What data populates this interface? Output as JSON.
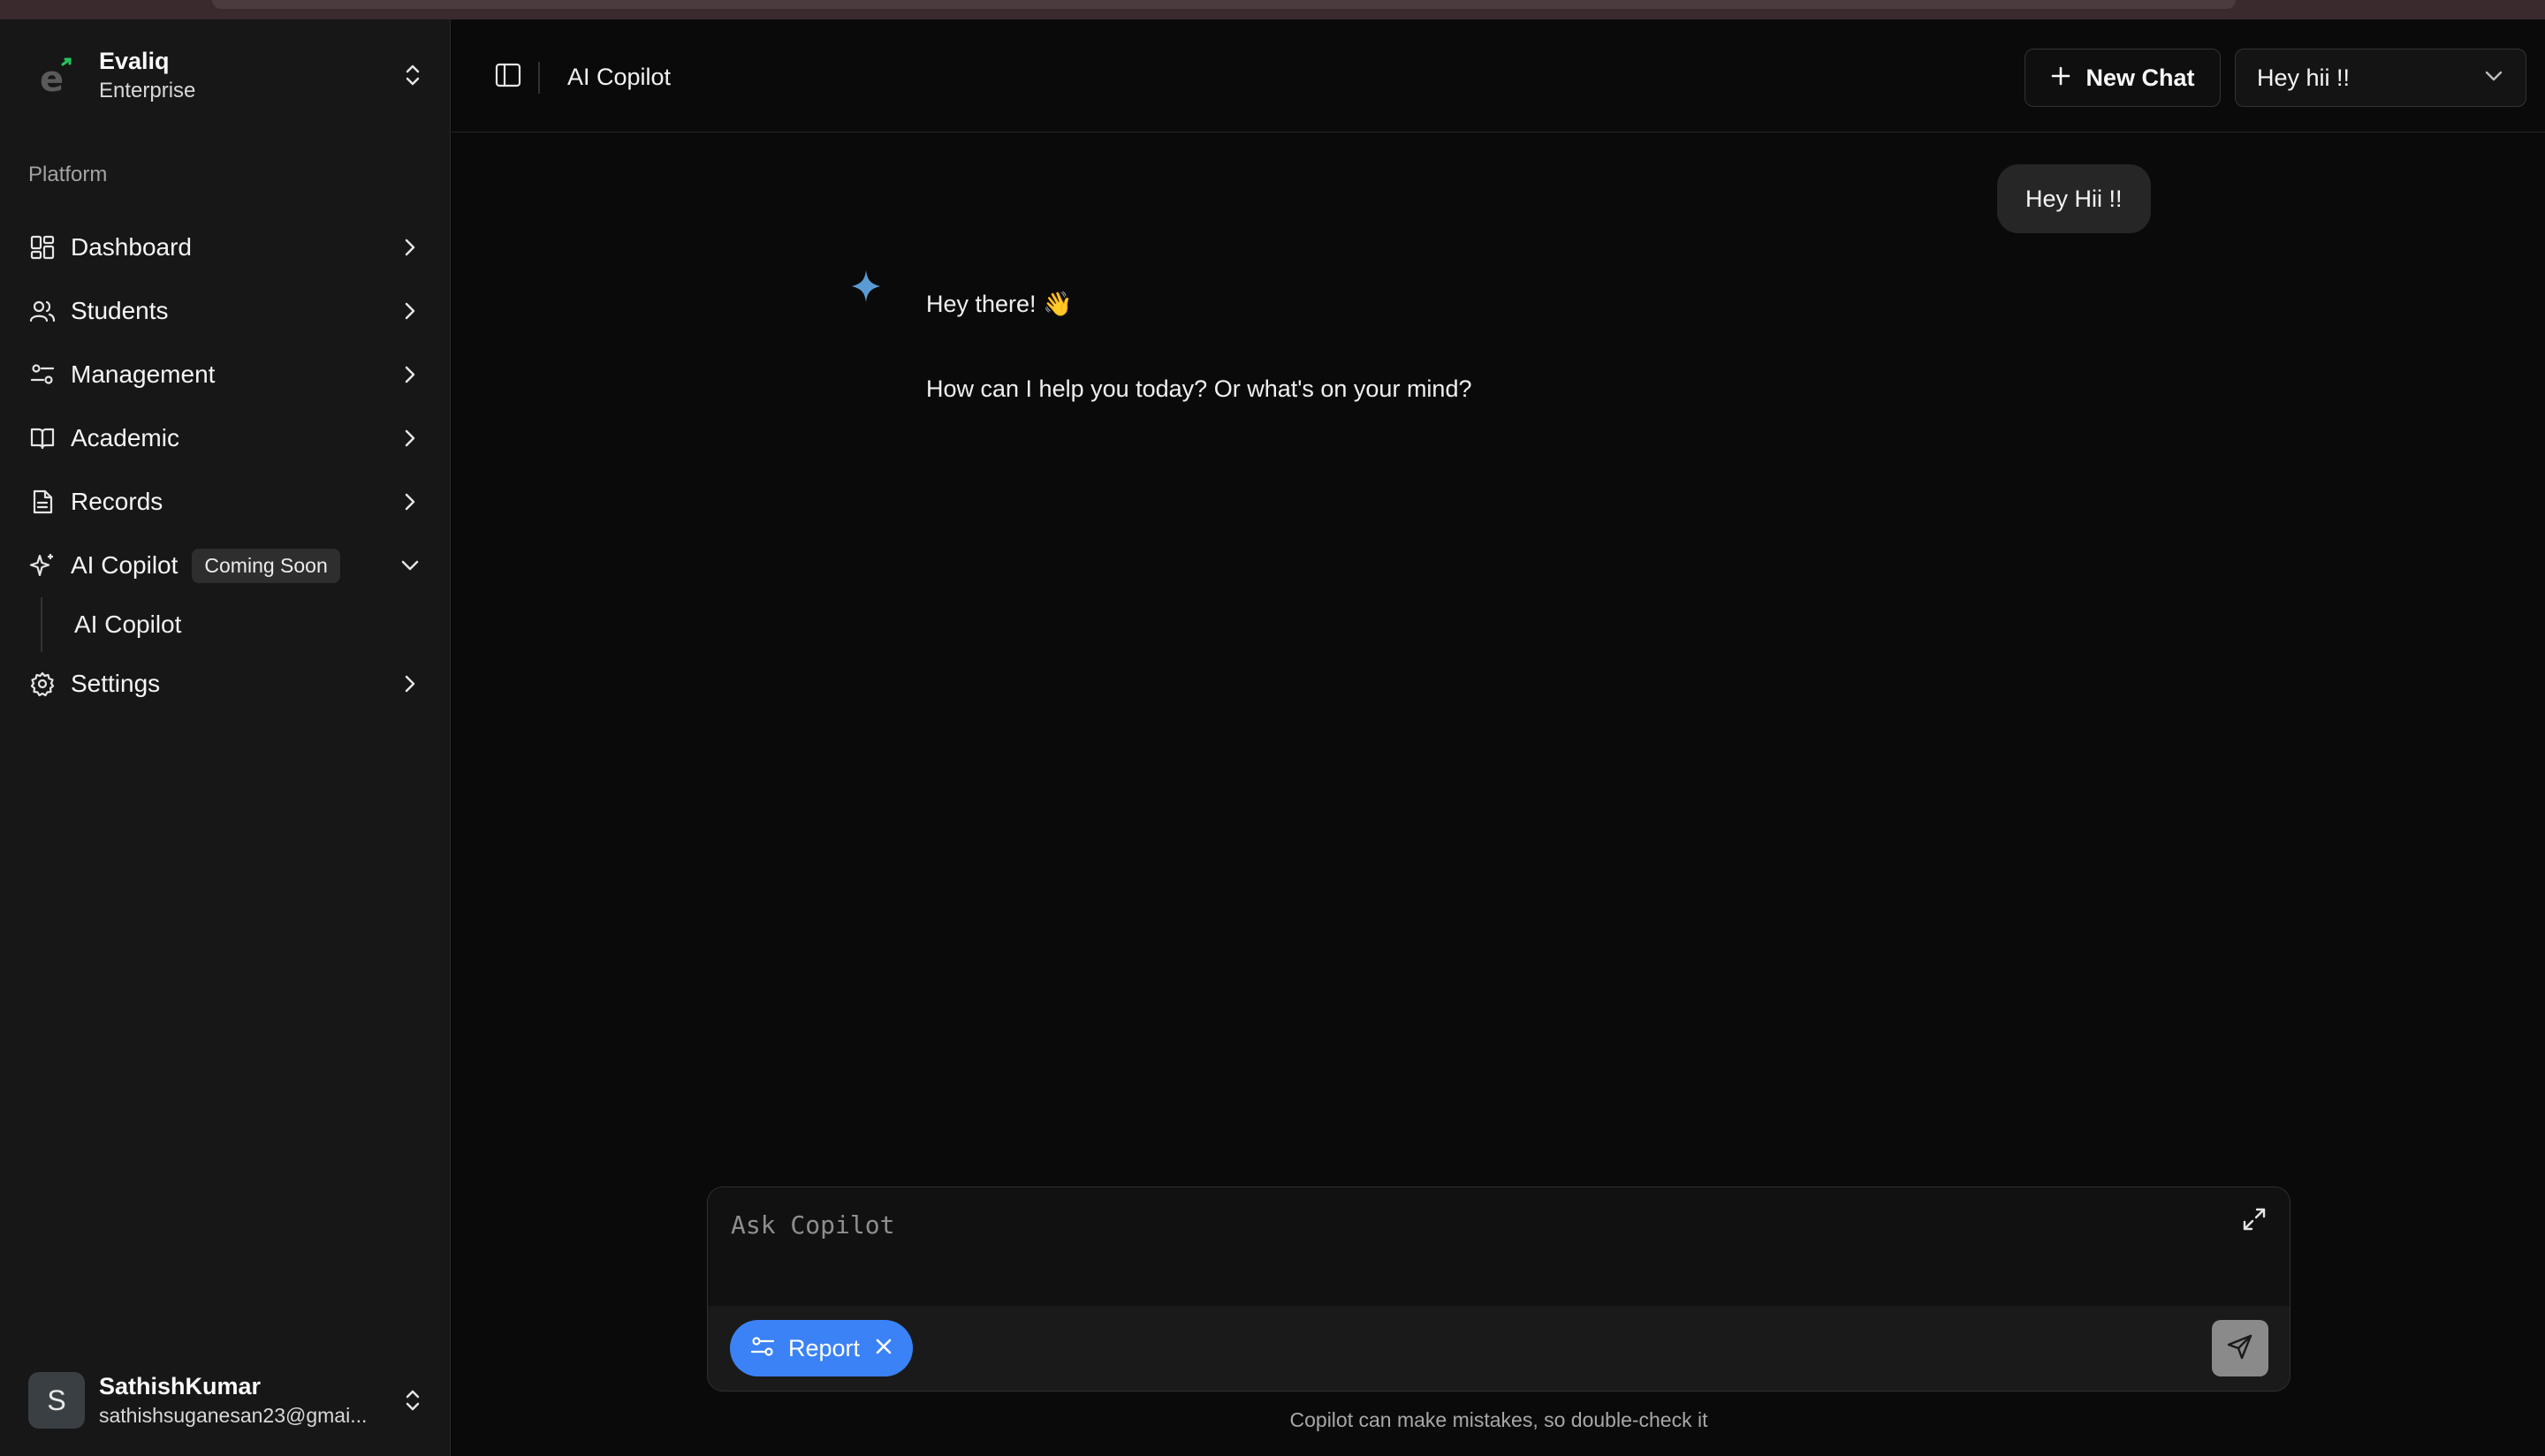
{
  "sidebar": {
    "org": {
      "name": "Evaliq",
      "plan": "Enterprise"
    },
    "section_label": "Platform",
    "items": [
      {
        "label": "Dashboard",
        "icon": "grid-icon"
      },
      {
        "label": "Students",
        "icon": "users-icon"
      },
      {
        "label": "Management",
        "icon": "sliders-icon"
      },
      {
        "label": "Academic",
        "icon": "book-icon"
      },
      {
        "label": "Records",
        "icon": "file-icon"
      },
      {
        "label": "AI Copilot",
        "icon": "sparkles-icon",
        "badge": "Coming Soon",
        "expanded": true,
        "children": [
          {
            "label": "AI Copilot"
          }
        ]
      },
      {
        "label": "Settings",
        "icon": "gear-icon"
      }
    ],
    "user": {
      "initial": "S",
      "name": "SathishKumar",
      "email": "sathishsuganesan23@gmai..."
    }
  },
  "header": {
    "title": "AI Copilot",
    "new_chat_label": "New Chat",
    "chat_select_value": "Hey hii !!"
  },
  "chat": {
    "user_message": "Hey Hii !!",
    "ai_line1": "Hey there! 👋",
    "ai_line2": "How can I help you today? Or what's on your mind?"
  },
  "composer": {
    "placeholder": "Ask Copilot",
    "chip_label": "Report",
    "disclaimer": "Copilot can make mistakes, so double-check it"
  },
  "colors": {
    "accent": "#3b82f6",
    "background": "#0a0a0a",
    "sidebar": "#171717",
    "logo_green": "#22c55e"
  }
}
